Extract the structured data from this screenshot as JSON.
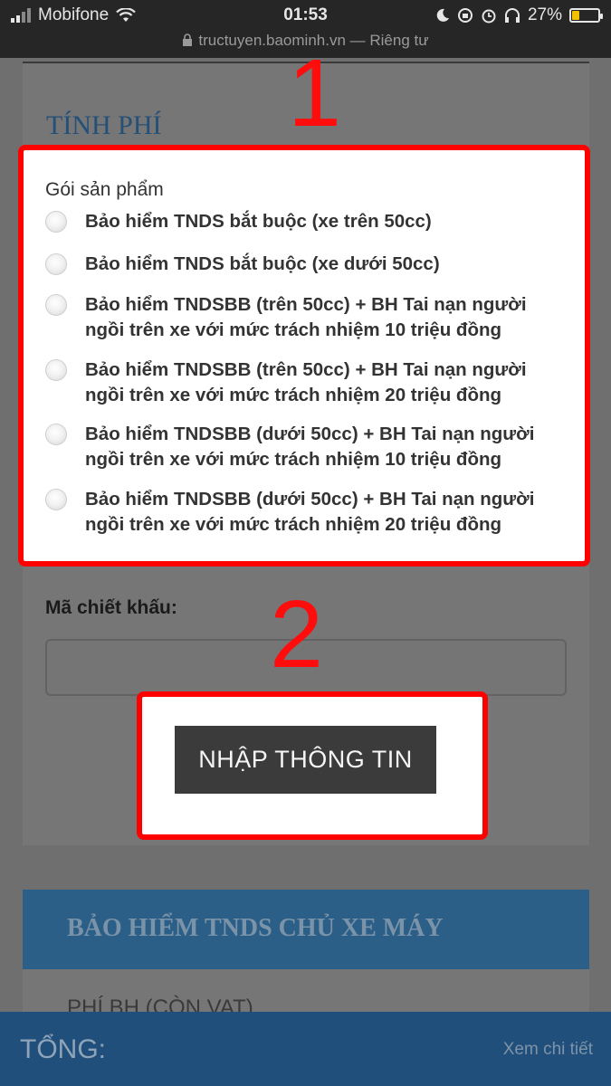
{
  "status_bar": {
    "carrier": "Mobifone",
    "time": "01:53",
    "battery": "27%",
    "battery_level": 0.27
  },
  "browser": {
    "domain": "tructuyen.baominh.vn",
    "separator": " — ",
    "privacy": "Riêng tư"
  },
  "form": {
    "section_title": "TÍNH PHÍ",
    "product_group_label": "Gói sản phẩm",
    "options": [
      "Bảo hiểm TNDS bắt buộc (xe trên 50cc)",
      "Bảo hiểm TNDS bắt buộc (xe dưới 50cc)",
      "Bảo hiểm TNDSBB (trên 50cc) + BH Tai nạn người ngồi trên xe với mức trách nhiệm 10 triệu đồng",
      "Bảo hiểm TNDSBB (trên 50cc) + BH Tai nạn người ngồi trên xe với mức trách nhiệm 20 triệu đồng",
      "Bảo hiểm TNDSBB (dưới 50cc) + BH Tai nạn người ngồi trên xe với mức trách nhiệm 10 triệu đồng",
      "Bảo hiểm TNDSBB (dưới 50cc) + BH Tai nạn người ngồi trên xe với mức trách nhiệm 20 triệu đồng"
    ],
    "discount_label": "Mã chiết khấu:",
    "discount_value": "",
    "submit_label": "NHẬP THÔNG TIN"
  },
  "annotations": {
    "step1": "1",
    "step2": "2"
  },
  "summary": {
    "panel_title": "BẢO HIỂM TNDS CHỦ XE MÁY",
    "fee_label": "PHÍ BH (CÒN VAT)",
    "total_label": "TỔNG:",
    "details_link": "Xem chi tiết"
  },
  "colors": {
    "annotation": "#ff0000",
    "brand_blue": "#2c5f88",
    "button": "#3b3b3b"
  }
}
